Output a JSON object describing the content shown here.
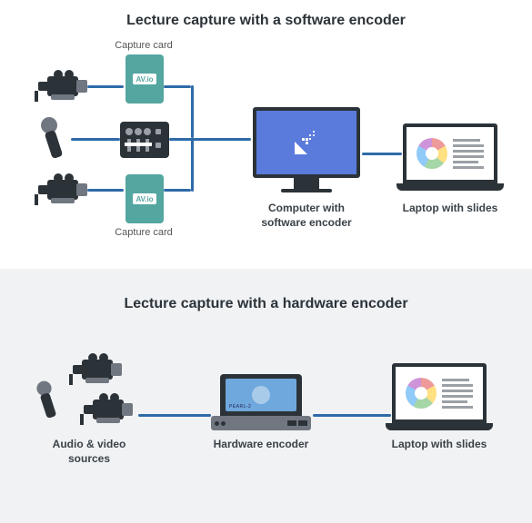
{
  "top": {
    "title": "Lecture capture with a software encoder",
    "capture_card_top": "Capture card",
    "capture_card_bottom": "Capture card",
    "card_brand": "AV.io",
    "monitor_label": "Computer with\nsoftware encoder",
    "laptop_label": "Laptop with slides"
  },
  "bottom": {
    "title": "Lecture capture with a hardware encoder",
    "sources_label": "Audio & video\nsources",
    "encoder_label": "Hardware encoder",
    "laptop_label": "Laptop with slides"
  }
}
